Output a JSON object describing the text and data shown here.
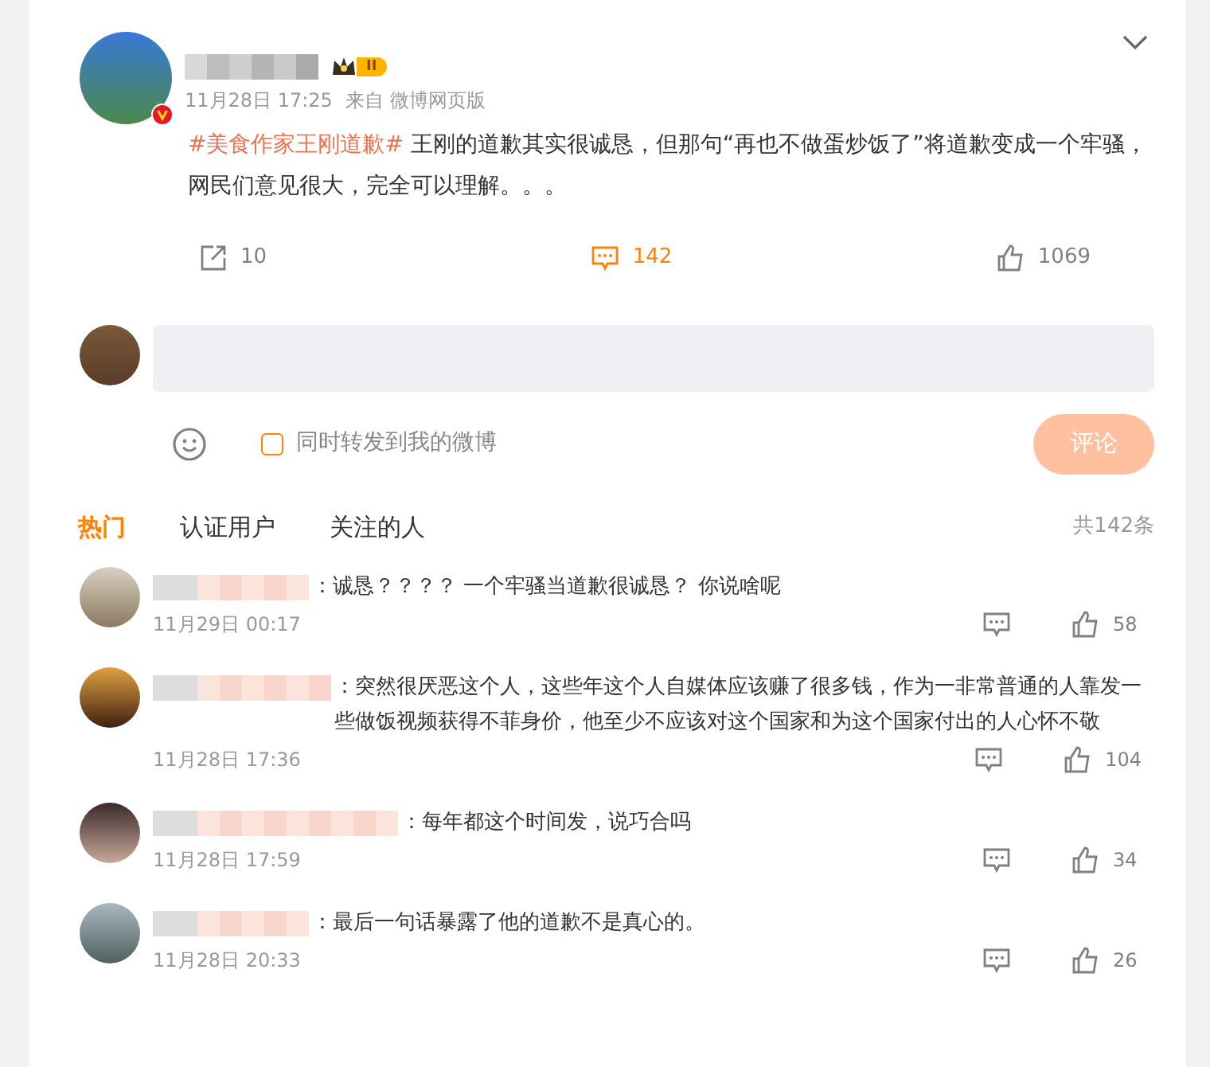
{
  "post": {
    "level_badge": "II",
    "verified": true,
    "time": "11月28日 17:25",
    "source": "来自 微博网页版",
    "hashtag": "#美食作家王刚道歉#",
    "text": " 王刚的道歉其实很诚恳，但那句“再也不做蛋炒饭了”将道歉变成一个牢骚，网民们意见很大，完全可以理解。。。",
    "actions": [
      {
        "kind": "repost",
        "count": "10",
        "active": false
      },
      {
        "kind": "comment",
        "count": "142",
        "active": true
      },
      {
        "kind": "like",
        "count": "1069",
        "active": false
      }
    ]
  },
  "composer": {
    "also_repost_label": "同时转发到我的微博",
    "also_repost_checked": false,
    "submit": "评论",
    "submit_disabled": true
  },
  "tabs": [
    {
      "label": "热门",
      "selected": true
    },
    {
      "label": "认证用户",
      "selected": false
    },
    {
      "label": "关注的人",
      "selected": false
    }
  ],
  "total": "共142条",
  "comments": [
    {
      "text": "：诚恳？？？？ 一个牢骚当道歉很诚恳？ 你说啥呢",
      "time": "11月29日 00:17",
      "likes": "58"
    },
    {
      "text": "：突然很厌恶这个人，这些年这个人自媒体应该赚了很多钱，作为一非常普通的人靠发一些做饭视频获得不菲身价，他至少不应该对这个国家和为这个国家付出的人心怀不敬",
      "time": "11月28日 17:36",
      "likes": "104"
    },
    {
      "text": "：每年都这个时间发，说巧合吗",
      "time": "11月28日 17:59",
      "likes": "34"
    },
    {
      "text": "：最后一句话暴露了他的道歉不是真心的。",
      "time": "11月28日 20:33",
      "likes": "26"
    }
  ]
}
